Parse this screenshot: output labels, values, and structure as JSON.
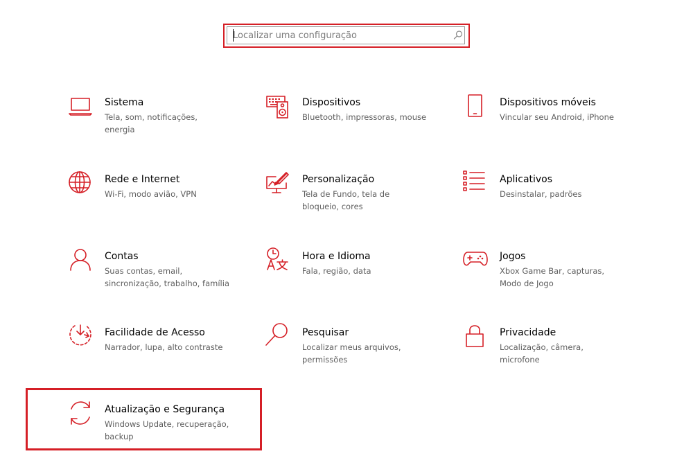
{
  "accent_color": "#d51f26",
  "search": {
    "placeholder": "Localizar uma configuração",
    "icon": "search-icon"
  },
  "categories": [
    {
      "icon": "laptop-icon",
      "title": "Sistema",
      "desc": "Tela, som, notificações, energia"
    },
    {
      "icon": "keyboard-speaker-icon",
      "title": "Dispositivos",
      "desc": "Bluetooth, impressoras, mouse"
    },
    {
      "icon": "phone-icon",
      "title": "Dispositivos móveis",
      "desc": "Vincular seu Android, iPhone"
    },
    {
      "icon": "globe-icon",
      "title": "Rede e Internet",
      "desc": "Wi-Fi, modo avião, VPN"
    },
    {
      "icon": "paint-brush-icon",
      "title": "Personalização",
      "desc": "Tela de Fundo, tela de bloqueio, cores"
    },
    {
      "icon": "apps-list-icon",
      "title": "Aplicativos",
      "desc": "Desinstalar, padrões"
    },
    {
      "icon": "person-icon",
      "title": "Contas",
      "desc": "Suas contas, email, sincronização, trabalho, família"
    },
    {
      "icon": "time-language-icon",
      "title": "Hora e Idioma",
      "desc": "Fala, região, data"
    },
    {
      "icon": "gamepad-icon",
      "title": "Jogos",
      "desc": "Xbox Game Bar, capturas, Modo de Jogo"
    },
    {
      "icon": "ease-of-access-icon",
      "title": "Facilidade de Acesso",
      "desc": "Narrador, lupa, alto contraste"
    },
    {
      "icon": "magnifier-icon",
      "title": "Pesquisar",
      "desc": "Localizar meus arquivos, permissões"
    },
    {
      "icon": "lock-icon",
      "title": "Privacidade",
      "desc": "Localização, câmera, microfone"
    },
    {
      "icon": "sync-arrows-icon",
      "title": "Atualização e Segurança",
      "desc": "Windows Update, recuperação, backup"
    }
  ]
}
